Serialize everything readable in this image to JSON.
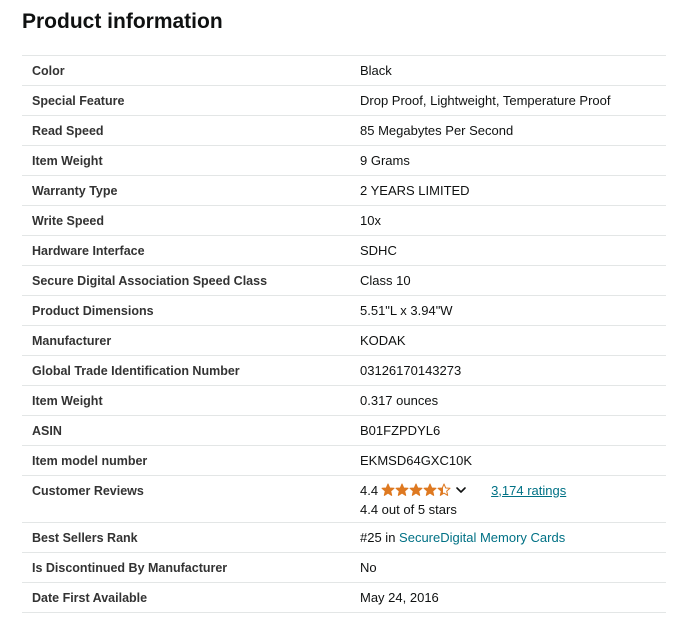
{
  "title": "Product information",
  "rows": [
    {
      "label": "Color",
      "value": "Black"
    },
    {
      "label": "Special Feature",
      "value": "Drop Proof, Lightweight, Temperature Proof"
    },
    {
      "label": "Read Speed",
      "value": "85 Megabytes Per Second"
    },
    {
      "label": "Item Weight",
      "value": "9 Grams"
    },
    {
      "label": "Warranty Type",
      "value": "2 YEARS LIMITED"
    },
    {
      "label": "Write Speed",
      "value": "10x"
    },
    {
      "label": "Hardware Interface",
      "value": "SDHC"
    },
    {
      "label": "Secure Digital Association Speed Class",
      "value": "Class 10"
    },
    {
      "label": "Product Dimensions",
      "value": "5.51\"L x 3.94\"W"
    },
    {
      "label": "Manufacturer",
      "value": "KODAK"
    },
    {
      "label": "Global Trade Identification Number",
      "value": "03126170143273"
    },
    {
      "label": "Item Weight",
      "value": "0.317 ounces"
    },
    {
      "label": "ASIN",
      "value": "B01FZPDYL6"
    },
    {
      "label": "Item model number",
      "value": "EKMSD64GXC10K"
    }
  ],
  "reviews": {
    "label": "Customer Reviews",
    "rating": "4.4",
    "stars": 4.4,
    "star_color": "#de7921",
    "ratings_link": "3,174 ratings",
    "out_of": "4.4 out of 5 stars"
  },
  "rank": {
    "label": "Best Sellers Rank",
    "prefix": "#25 in ",
    "link": "SecureDigital Memory Cards",
    "link_color": "#007185"
  },
  "tail_rows": [
    {
      "label": "Is Discontinued By Manufacturer",
      "value": "No"
    },
    {
      "label": "Date First Available",
      "value": "May 24, 2016"
    }
  ]
}
